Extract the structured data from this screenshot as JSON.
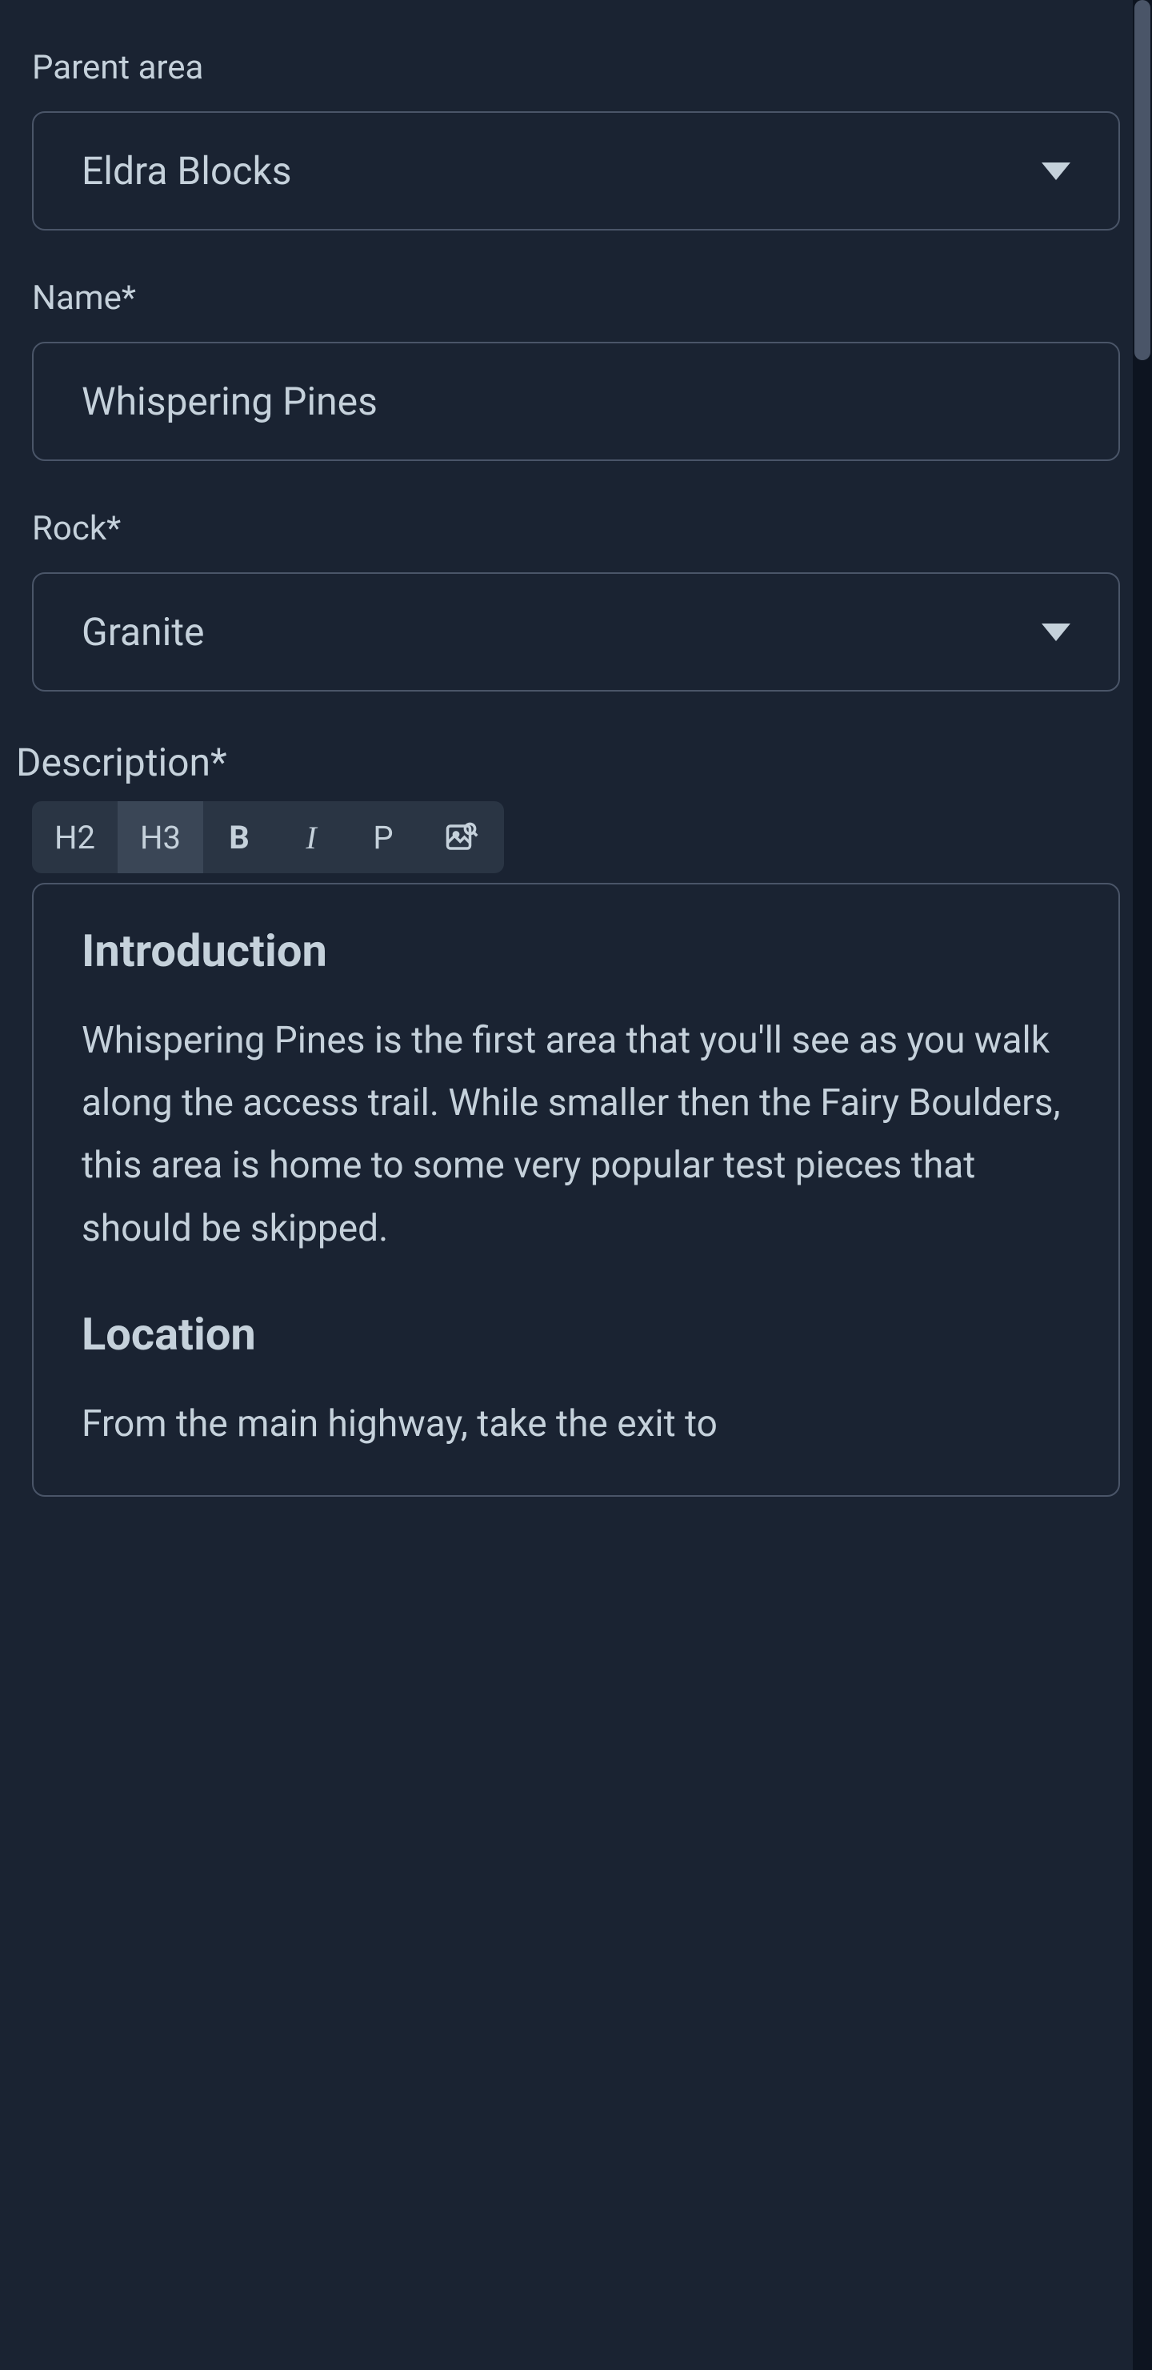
{
  "form": {
    "parentArea": {
      "label": "Parent area",
      "value": "Eldra Blocks"
    },
    "name": {
      "label": "Name*",
      "value": "Whispering Pines"
    },
    "rock": {
      "label": "Rock*",
      "value": "Granite"
    },
    "description": {
      "label": "Description*"
    }
  },
  "toolbar": {
    "h2": "H2",
    "h3": "H3",
    "bold": "B",
    "italic": "I",
    "paragraph": "P"
  },
  "editor": {
    "heading1": "Introduction",
    "paragraph1": "Whispering Pines is the first area that you'll see as you walk along the access trail. While smaller then the Fairy Boulders, this area is home to some very popular test pieces that should be skipped.",
    "heading2": "Location",
    "paragraph2": "From the main highway, take the exit to"
  }
}
